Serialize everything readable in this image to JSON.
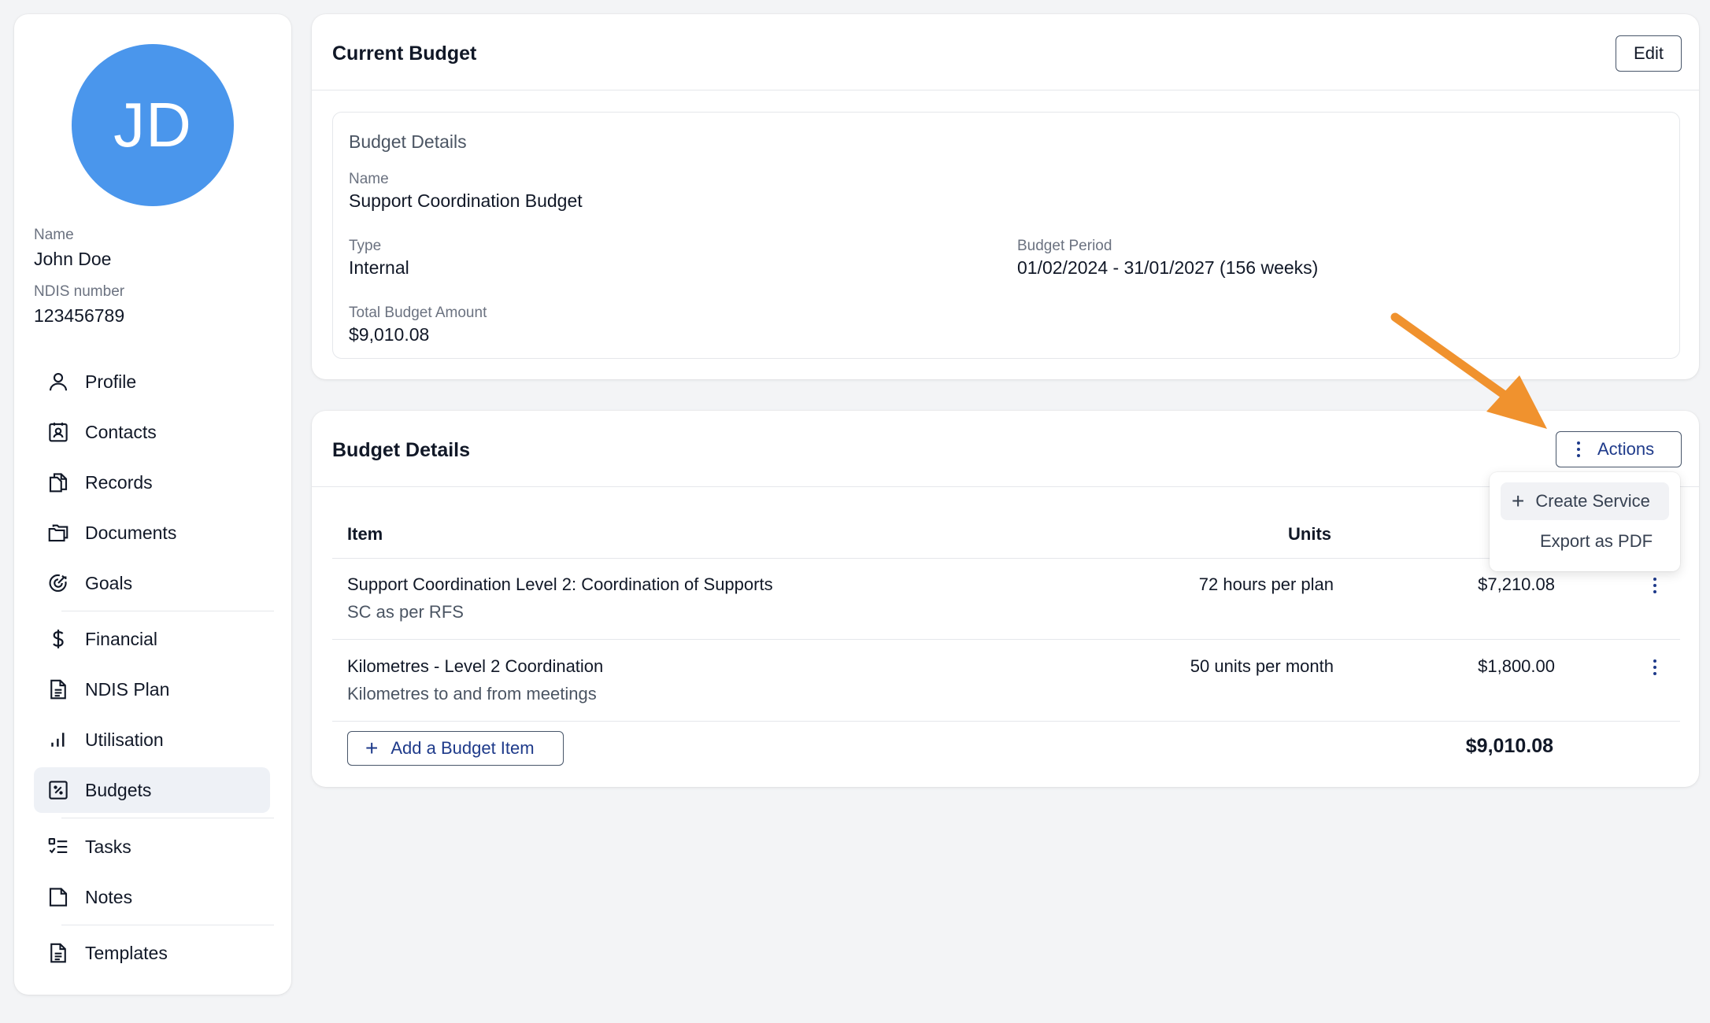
{
  "sidebar": {
    "avatar_initials": "JD",
    "name_label": "Name",
    "name_value": "John Doe",
    "ndis_label": "NDIS number",
    "ndis_value": "123456789",
    "nav": [
      {
        "label": "Profile",
        "icon": "person-icon"
      },
      {
        "label": "Contacts",
        "icon": "contact-card-icon"
      },
      {
        "label": "Records",
        "icon": "records-icon"
      },
      {
        "label": "Documents",
        "icon": "folders-icon"
      },
      {
        "label": "Goals",
        "icon": "target-icon"
      },
      {
        "label": "Financial",
        "icon": "dollar-icon"
      },
      {
        "label": "NDIS Plan",
        "icon": "document-icon"
      },
      {
        "label": "Utilisation",
        "icon": "bar-chart-icon"
      },
      {
        "label": "Budgets",
        "icon": "percent-box-icon",
        "active": true
      },
      {
        "label": "Tasks",
        "icon": "checklist-icon"
      },
      {
        "label": "Notes",
        "icon": "note-icon"
      },
      {
        "label": "Templates",
        "icon": "template-icon"
      }
    ]
  },
  "current_budget": {
    "title": "Current Budget",
    "edit_label": "Edit",
    "details_heading": "Budget Details",
    "name_label": "Name",
    "name_value": "Support Coordination Budget",
    "type_label": "Type",
    "type_value": "Internal",
    "period_label": "Budget Period",
    "period_value": "01/02/2024 - 31/01/2027 (156 weeks)",
    "total_label": "Total Budget Amount",
    "total_value": "$9,010.08"
  },
  "budget_details": {
    "title": "Budget Details",
    "actions_label": "Actions",
    "col_item": "Item",
    "col_units": "Units",
    "rows": [
      {
        "title": "Support Coordination Level 2: Coordination of Supports",
        "subtitle": "SC as per RFS",
        "units": "72 hours per plan",
        "amount": "$7,210.08"
      },
      {
        "title": "Kilometres - Level 2 Coordination",
        "subtitle": "Kilometres to and from meetings",
        "units": "50 units per month",
        "amount": "$1,800.00"
      }
    ],
    "add_item_label": "Add a Budget Item",
    "total": "$9,010.08"
  },
  "actions_menu": {
    "create_service": "Create Service",
    "export_pdf": "Export as PDF"
  },
  "colors": {
    "avatar": "#4a96ec",
    "annotation_arrow": "#f0922e",
    "accent_dark": "#1e3a8a"
  }
}
